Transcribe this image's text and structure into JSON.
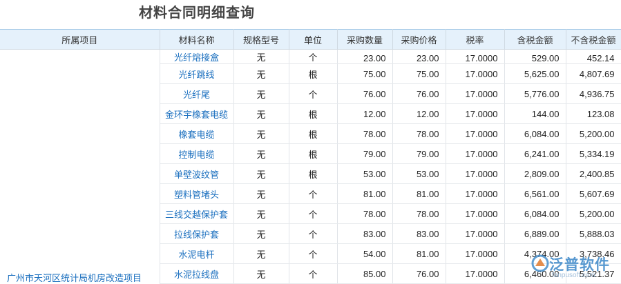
{
  "page_title": "材料合同明细查询",
  "columns": [
    "所属项目",
    "材料名称",
    "规格型号",
    "单位",
    "采购数量",
    "采购价格",
    "税率",
    "含税金额",
    "不含税金额"
  ],
  "project": "广州市天河区统计局机房改造项目",
  "rows": [
    {
      "name": "光纤熔接盒",
      "spec": "无",
      "unit": "个",
      "qty": "23.00",
      "price": "23.00",
      "rate": "17.0000",
      "amount_tax": "529.00",
      "amount_notax": "452.14"
    },
    {
      "name": "光纤跳线",
      "spec": "无",
      "unit": "根",
      "qty": "75.00",
      "price": "75.00",
      "rate": "17.0000",
      "amount_tax": "5,625.00",
      "amount_notax": "4,807.69"
    },
    {
      "name": "光纤尾",
      "spec": "无",
      "unit": "个",
      "qty": "76.00",
      "price": "76.00",
      "rate": "17.0000",
      "amount_tax": "5,776.00",
      "amount_notax": "4,936.75"
    },
    {
      "name": "金环宇橡套电缆",
      "spec": "无",
      "unit": "根",
      "qty": "12.00",
      "price": "12.00",
      "rate": "17.0000",
      "amount_tax": "144.00",
      "amount_notax": "123.08"
    },
    {
      "name": "橡套电缆",
      "spec": "无",
      "unit": "根",
      "qty": "78.00",
      "price": "78.00",
      "rate": "17.0000",
      "amount_tax": "6,084.00",
      "amount_notax": "5,200.00"
    },
    {
      "name": "控制电缆",
      "spec": "无",
      "unit": "根",
      "qty": "79.00",
      "price": "79.00",
      "rate": "17.0000",
      "amount_tax": "6,241.00",
      "amount_notax": "5,334.19"
    },
    {
      "name": "单壁波纹管",
      "spec": "无",
      "unit": "根",
      "qty": "53.00",
      "price": "53.00",
      "rate": "17.0000",
      "amount_tax": "2,809.00",
      "amount_notax": "2,400.85"
    },
    {
      "name": "塑料管堵头",
      "spec": "无",
      "unit": "个",
      "qty": "81.00",
      "price": "81.00",
      "rate": "17.0000",
      "amount_tax": "6,561.00",
      "amount_notax": "5,607.69"
    },
    {
      "name": "三线交越保护套",
      "spec": "无",
      "unit": "个",
      "qty": "78.00",
      "price": "78.00",
      "rate": "17.0000",
      "amount_tax": "6,084.00",
      "amount_notax": "5,200.00"
    },
    {
      "name": "拉线保护套",
      "spec": "无",
      "unit": "个",
      "qty": "83.00",
      "price": "83.00",
      "rate": "17.0000",
      "amount_tax": "6,889.00",
      "amount_notax": "5,888.03"
    },
    {
      "name": "水泥电杆",
      "spec": "无",
      "unit": "个",
      "qty": "54.00",
      "price": "81.00",
      "rate": "17.0000",
      "amount_tax": "4,374.00",
      "amount_notax": "3,738.46"
    },
    {
      "name": "水泥拉线盘",
      "spec": "无",
      "unit": "个",
      "qty": "85.00",
      "price": "76.00",
      "rate": "17.0000",
      "amount_tax": "6,460.00",
      "amount_notax": "5,521.37"
    }
  ],
  "watermark": {
    "brand": "泛普软件",
    "sub": "fanpusoft.com",
    "color": "#3a87c8"
  }
}
